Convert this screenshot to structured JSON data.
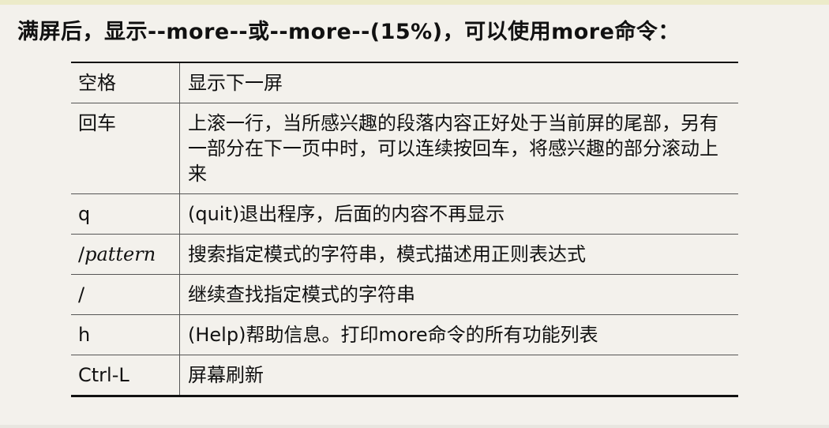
{
  "heading": "满屏后，显示--more--或--more--(15%)，可以使用more命令：",
  "table": {
    "rows": [
      {
        "key": "空格",
        "key_style": "normal",
        "desc": "显示下一屏"
      },
      {
        "key": "回车",
        "key_style": "normal",
        "desc": "上滚一行，当所感兴趣的段落内容正好处于当前屏的尾部，另有一部分在下一页中时，可以连续按回车，将感兴趣的部分滚动上来"
      },
      {
        "key": "q",
        "key_style": "normal",
        "desc": "(quit)退出程序，后面的内容不再显示"
      },
      {
        "key_prefix": "/",
        "key_italic": "pattern",
        "key_style": "slash-italic",
        "desc": "搜索指定模式的字符串，模式描述用正则表达式"
      },
      {
        "key": "/",
        "key_style": "normal",
        "desc": "继续查找指定模式的字符串"
      },
      {
        "key": "h",
        "key_style": "normal",
        "desc": "(Help)帮助信息。打印more命令的所有功能列表"
      },
      {
        "key": "Ctrl-L",
        "key_style": "normal",
        "desc": "屏幕刷新"
      }
    ]
  }
}
